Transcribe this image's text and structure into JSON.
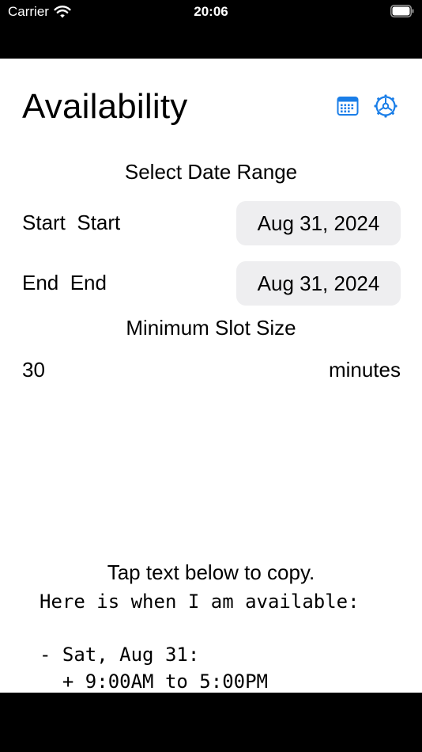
{
  "status_bar": {
    "carrier": "Carrier",
    "time": "20:06"
  },
  "header": {
    "title": "Availability",
    "calendar_icon": "calendar-icon",
    "settings_icon": "gear-icon"
  },
  "date_range": {
    "heading": "Select Date Range",
    "start_label": "Start  Start",
    "start_value": "Aug 31, 2024",
    "end_label": "End  End",
    "end_value": "Aug 31, 2024"
  },
  "slot": {
    "heading": "Minimum Slot Size",
    "value": "30",
    "unit": "minutes"
  },
  "output": {
    "hint": "Tap text below to copy.",
    "text": "Here is when I am available:\n\n- Sat, Aug 31:\n  + 9:00AM to 5:00PM"
  },
  "colors": {
    "accent": "#1a7ee8",
    "pill_background": "#eeeef0"
  }
}
